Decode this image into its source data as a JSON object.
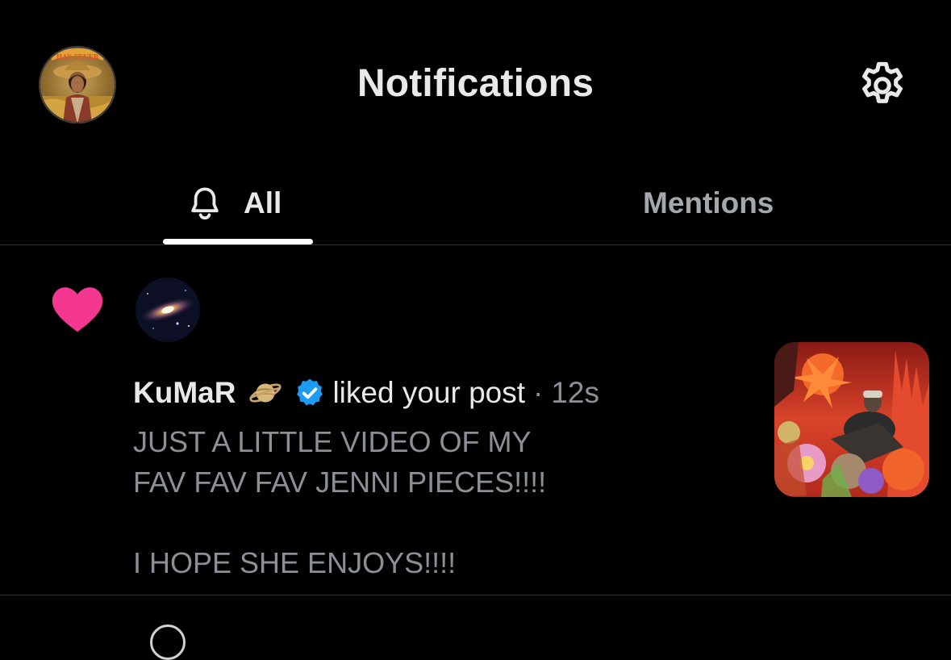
{
  "header": {
    "title": "Notifications",
    "profile_avatar_text": "HAY FEVER",
    "settings_icon": "gear-icon"
  },
  "tabs": [
    {
      "label": "All",
      "icon": "bell-icon",
      "active": true
    },
    {
      "label": "Mentions",
      "active": false
    }
  ],
  "colors": {
    "background": "#000000",
    "like": "#f4388f",
    "verified": "#1d9bf0",
    "text_primary": "#e7e9ea",
    "text_secondary": "#8b9096",
    "divider": "#2f3336"
  },
  "notifications": [
    {
      "type": "like",
      "icon": "heart-icon",
      "user": {
        "name": "KuMaR",
        "emoji": "🪐",
        "verified": true,
        "avatar": "galaxy-image"
      },
      "action": "liked your post",
      "separator": "·",
      "time": "12s",
      "post_text": "JUST A LITTLE VIDEO OF MY\nFAV FAV FAV JENNI PIECES!!!!\n\nI HOPE SHE ENJOYS!!!!",
      "thumbnail": "collage-image"
    }
  ]
}
